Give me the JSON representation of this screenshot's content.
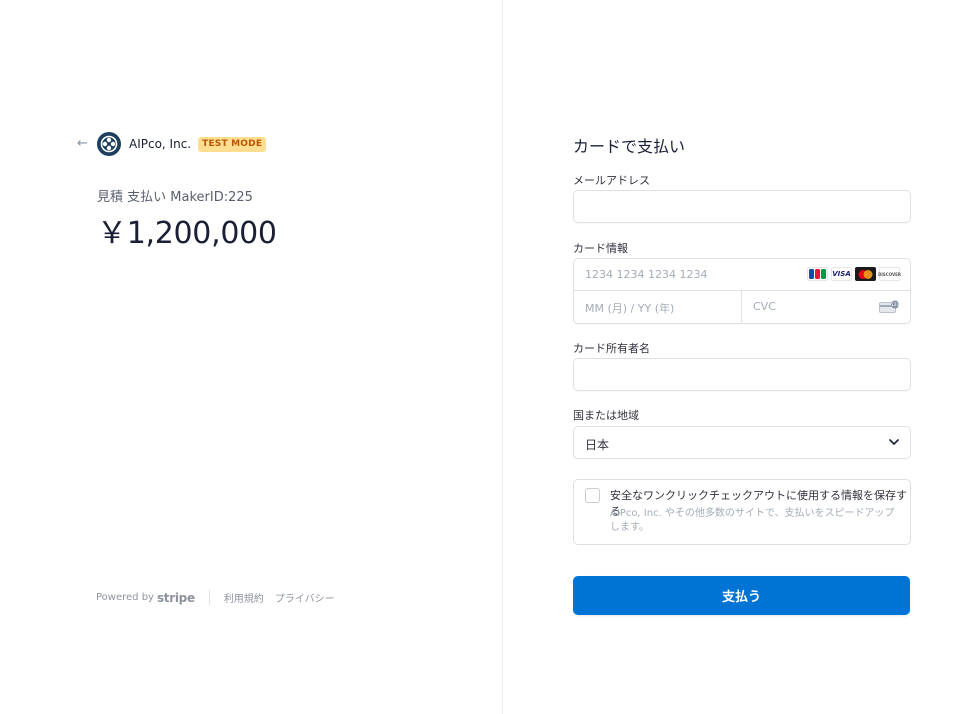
{
  "merchant": {
    "name": "AIPco, Inc.",
    "test_badge": "TEST MODE"
  },
  "product": {
    "name": "見積 支払い MakerID:225",
    "price": "￥1,200,000"
  },
  "footer": {
    "powered_by": "Powered by",
    "stripe": "stripe",
    "terms": "利用規約",
    "privacy": "プライバシー"
  },
  "form": {
    "title": "カードで支払い",
    "email_label": "メールアドレス",
    "card_label": "カード情報",
    "card_number_placeholder": "1234 1234 1234 1234",
    "expiry_placeholder": "MM (月) / YY (年)",
    "cvc_placeholder": "CVC",
    "card_brands": [
      "JCB",
      "VISA",
      "Mastercard",
      "DISCOVER"
    ],
    "cardholder_label": "カード所有者名",
    "country_label": "国または地域",
    "country_value": "日本",
    "save_info_title": "安全なワンクリックチェックアウトに使用する情報を保存する",
    "save_info_desc": "AIPco, Inc. やその他多数のサイトで、支払いをスピードアップします。",
    "pay_button": "支払う"
  },
  "colors": {
    "accent": "#0074d4",
    "test_badge_bg": "#ffde92",
    "test_badge_text": "#bb5504",
    "logo_bg": "#1d3f5e"
  }
}
